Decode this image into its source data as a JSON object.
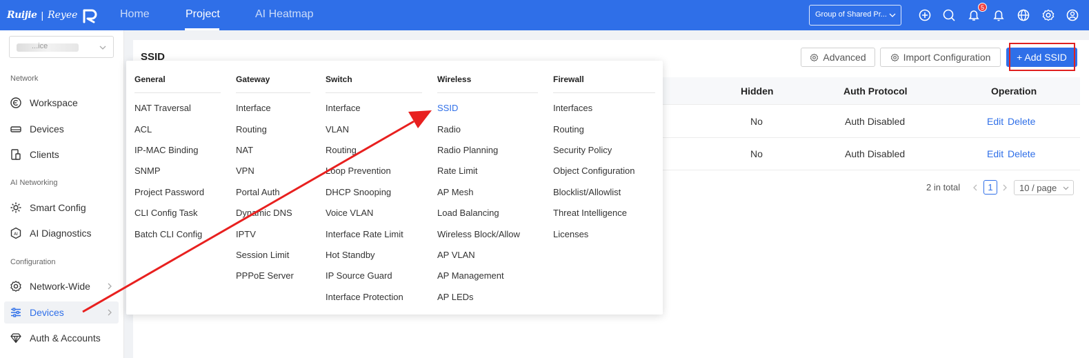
{
  "header": {
    "logo_text": "Ruijie",
    "logo_sep": "|",
    "logo_text2": "Reyee",
    "nav": [
      {
        "label": "Home"
      },
      {
        "label": "Project"
      },
      {
        "label": "AI Heatmap"
      }
    ],
    "group_select": "Group of Shared Pr...",
    "notification_count": "5"
  },
  "sidebar": {
    "site_text": "...ice",
    "sections": {
      "network": "Network",
      "ai_networking": "AI Networking",
      "configuration": "Configuration"
    },
    "items": [
      {
        "label": "Workspace"
      },
      {
        "label": "Devices"
      },
      {
        "label": "Clients"
      },
      {
        "label": "Smart Config"
      },
      {
        "label": "AI Diagnostics"
      },
      {
        "label": "Network-Wide"
      },
      {
        "label": "Devices"
      },
      {
        "label": "Auth & Accounts"
      }
    ]
  },
  "page": {
    "title": "SSID",
    "advanced_label": "Advanced",
    "import_label": "Import Configuration",
    "add_label": "+ Add SSID"
  },
  "table": {
    "headers": [
      "Hidden",
      "Auth Protocol",
      "Operation"
    ],
    "rows": [
      {
        "hidden": "No",
        "auth": "Auth Disabled",
        "edit": "Edit",
        "delete": "Delete"
      },
      {
        "hidden": "No",
        "auth": "Auth Disabled",
        "edit": "Edit",
        "delete": "Delete"
      }
    ]
  },
  "pager": {
    "total": "2 in total",
    "current": "1",
    "page_size": "10 / page"
  },
  "mega_menu": {
    "columns": [
      {
        "title": "General",
        "items": [
          "NAT Traversal",
          "ACL",
          "IP-MAC Binding",
          "SNMP",
          "Project Password",
          "CLI Config Task",
          "Batch CLI Config"
        ]
      },
      {
        "title": "Gateway",
        "items": [
          "Interface",
          "Routing",
          "NAT",
          "VPN",
          "Portal Auth",
          "Dynamic DNS",
          "IPTV",
          "Session Limit",
          "PPPoE Server"
        ]
      },
      {
        "title": "Switch",
        "items": [
          "Interface",
          "VLAN",
          "Routing",
          "Loop Prevention",
          "DHCP Snooping",
          "Voice VLAN",
          "Interface Rate Limit",
          "Hot Standby",
          "IP Source Guard",
          "Interface Protection"
        ]
      },
      {
        "title": "Wireless",
        "items": [
          "SSID",
          "Radio",
          "Radio Planning",
          "Rate Limit",
          "AP Mesh",
          "Load Balancing",
          "Wireless Block/Allow",
          "AP VLAN",
          "AP Management",
          "AP LEDs"
        ]
      },
      {
        "title": "Firewall",
        "items": [
          "Interfaces",
          "Routing",
          "Security Policy",
          "Object Configuration",
          "Blocklist/Allowlist",
          "Threat Intelligence",
          "Licenses"
        ]
      }
    ]
  },
  "colors": {
    "primary": "#2f6fe8",
    "annotation_red": "#e02020"
  }
}
